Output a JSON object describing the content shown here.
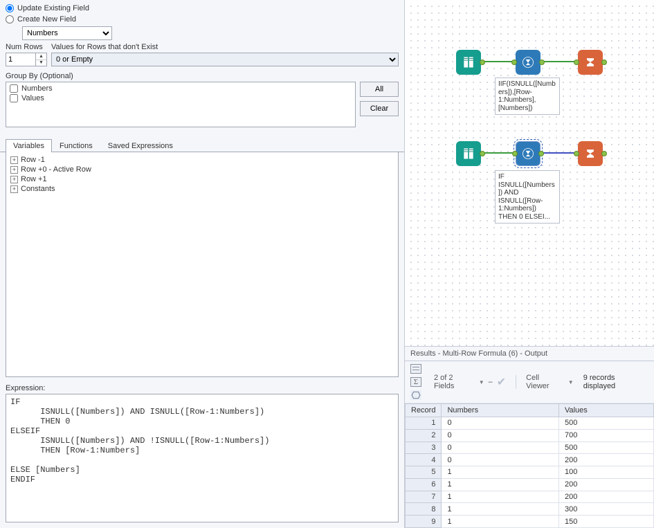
{
  "left": {
    "updateExisting": "Update Existing Field",
    "createNew": "Create New  Field",
    "fieldSelect": "Numbers",
    "numRowsLabel": "Num Rows",
    "numRowsValue": "1",
    "valuesForRowsLabel": "Values for Rows that don't Exist",
    "valuesForRowsSelect": "0 or Empty",
    "groupByLabel": "Group By (Optional)",
    "groupByItems": [
      "Numbers",
      "Values"
    ],
    "btnAll": "All",
    "btnClear": "Clear",
    "tabs": {
      "variables": "Variables",
      "functions": "Functions",
      "saved": "Saved Expressions"
    },
    "tree": [
      "Row -1",
      "Row +0 - Active Row",
      "Row +1",
      "Constants"
    ],
    "expressionLabel": "Expression:",
    "expression": "IF\n      ISNULL([Numbers]) AND ISNULL([Row-1:Numbers])\n      THEN 0\nELSEIF\n      ISNULL([Numbers]) AND !ISNULL([Row-1:Numbers])\n      THEN [Row-1:Numbers]\n\nELSE [Numbers]\nENDIF"
  },
  "canvas": {
    "annot1": "IIF(ISNULL([Numbers]),[Row-1:Numbers],[Numbers])",
    "annot2": "IF ISNULL([Numbers]) AND ISNULL([Row-1:Numbers]) THEN 0 ELSEI..."
  },
  "results": {
    "title": "Results - Multi-Row Formula (6) - Output",
    "fieldsText": "2 of 2 Fields",
    "cellViewer": "Cell Viewer",
    "recordsText": "9 records displayed",
    "headers": {
      "record": "Record",
      "numbers": "Numbers",
      "values": "Values"
    },
    "rows": [
      {
        "r": "1",
        "n": "0",
        "v": "500"
      },
      {
        "r": "2",
        "n": "0",
        "v": "700"
      },
      {
        "r": "3",
        "n": "0",
        "v": "500"
      },
      {
        "r": "4",
        "n": "0",
        "v": "200"
      },
      {
        "r": "5",
        "n": "1",
        "v": "100"
      },
      {
        "r": "6",
        "n": "1",
        "v": "200"
      },
      {
        "r": "7",
        "n": "1",
        "v": "200"
      },
      {
        "r": "8",
        "n": "1",
        "v": "300"
      },
      {
        "r": "9",
        "n": "1",
        "v": "150"
      }
    ]
  }
}
